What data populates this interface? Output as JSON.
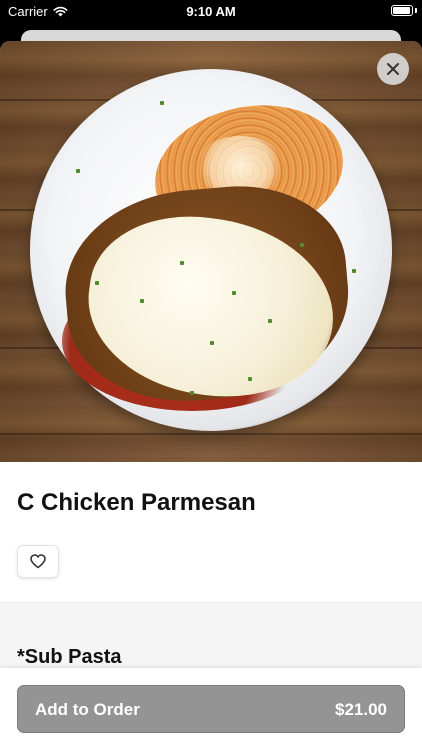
{
  "status_bar": {
    "carrier": "Carrier",
    "time": "9:10 AM",
    "battery_level": 0.95
  },
  "item": {
    "title": "C Chicken Parmesan",
    "image_icon": "photo-chicken-parmesan"
  },
  "icons": {
    "close": "close-icon",
    "favorite": "heart-outline-icon",
    "wifi": "wifi-icon",
    "battery": "battery-icon"
  },
  "section": {
    "title": "*Sub Pasta"
  },
  "footer": {
    "add_label": "Add to Order",
    "price": "$21.00"
  },
  "colors": {
    "button_bg": "#949494",
    "button_text": "#ffffff",
    "title_text": "#111111",
    "section_bg": "#f5f5f5"
  }
}
